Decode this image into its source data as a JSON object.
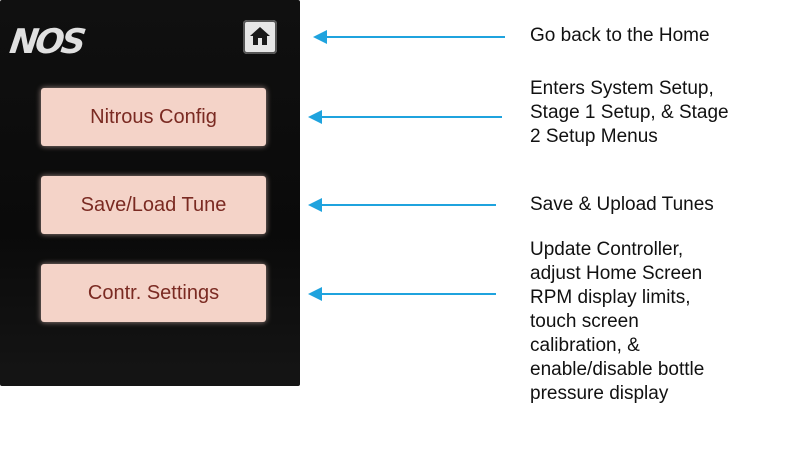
{
  "screen": {
    "logo": "NOS",
    "buttons": [
      {
        "label": "Nitrous Config"
      },
      {
        "label": "Save/Load Tune"
      },
      {
        "label": "Contr. Settings"
      }
    ]
  },
  "annotations": {
    "home": [
      "Go back to the Home"
    ],
    "nitrous": [
      "Enters System Setup,",
      "Stage 1 Setup, & Stage",
      "2 Setup Menus"
    ],
    "tune": [
      "Save & Upload Tunes"
    ],
    "settings": [
      "Update Controller,",
      "adjust Home Screen",
      "RPM display limits,",
      "touch screen",
      "calibration, &",
      "enable/disable bottle",
      "pressure display"
    ]
  },
  "colors": {
    "button_bg": "#f4d3c8",
    "button_text": "#7a2a22",
    "arrow": "#1fa3de"
  }
}
